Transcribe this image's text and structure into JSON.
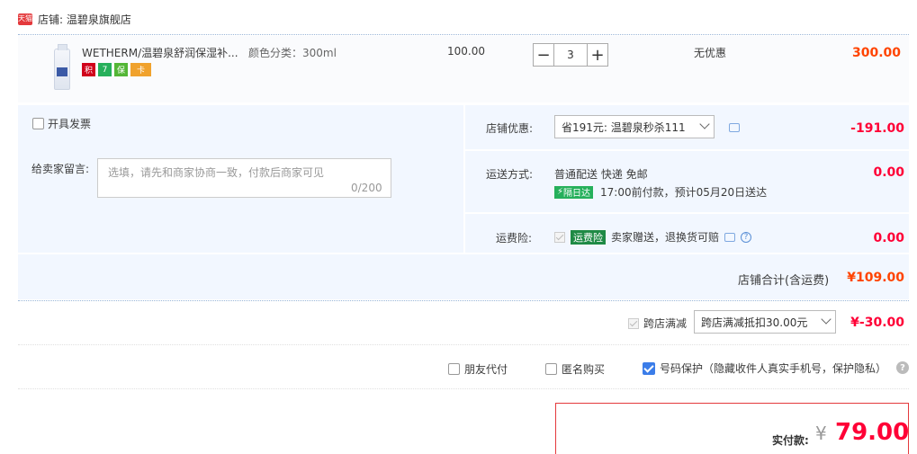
{
  "store": {
    "icon_text": "天猫",
    "label": "店铺: 温碧泉旗舰店"
  },
  "item": {
    "title": "WETHERM/温碧泉舒润保湿补...",
    "spec": "颜色分类：300ml",
    "badges": [
      "积",
      "7",
      "保",
      "卡"
    ],
    "unit_price": "100.00",
    "quantity": "3",
    "minus": "−",
    "plus": "+",
    "discount_status": "无优惠",
    "line_total": "300.00"
  },
  "invoice": {
    "label": "开具发票",
    "checked": false
  },
  "note": {
    "label": "给卖家留言:",
    "placeholder": "选填，请先和商家协商一致，付款后商家可见",
    "count": "0/200"
  },
  "store_discount": {
    "label": "店铺优惠:",
    "selected": "省191元: 温碧泉秒杀111",
    "amount": "-191.00"
  },
  "shipping": {
    "label": "运送方式:",
    "method": "普通配送 快递 免邮",
    "tag": "隔日达",
    "eta": "17:00前付款，预计05月20日送达",
    "amount": "0.00"
  },
  "insurance": {
    "label": "运费险:",
    "tag": "运费险",
    "desc": "卖家赠送，退换货可赔",
    "amount": "0.00",
    "help": "?"
  },
  "store_total": {
    "label": "店铺合计(含运费)",
    "value": "¥109.00"
  },
  "cross_store": {
    "label": "跨店满减",
    "selected": "跨店满减抵扣30.00元",
    "amount": "¥-30.00"
  },
  "options": {
    "friend_pay": "朋友代付",
    "anonymous": "匿名购买",
    "privacy": "号码保护（隐藏收件人真实手机号，保护隐私）",
    "privacy_checked": true,
    "help": "?"
  },
  "payment": {
    "label": "实付款:",
    "currency": "¥",
    "value": "79.00"
  },
  "colors": {
    "accent_red": "#ff0036",
    "price_orange": "#ff4400",
    "panel_bg": "#f2f7ff",
    "check_blue": "#3b7de9"
  }
}
